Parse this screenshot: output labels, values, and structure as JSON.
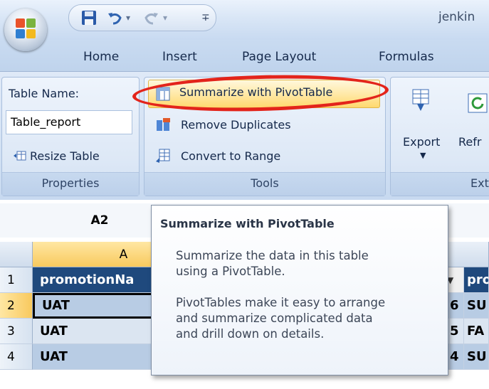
{
  "window": {
    "title": "jenkin"
  },
  "quick_access": {
    "save_icon": "save-icon",
    "undo_icon": "undo-icon",
    "redo_icon": "redo-icon",
    "customize_icon": "dropdown-icon"
  },
  "tabs": [
    "Home",
    "Insert",
    "Page Layout",
    "Formulas"
  ],
  "ribbon": {
    "properties": {
      "table_name_label": "Table Name:",
      "table_name_value": "Table_report",
      "resize_label": "Resize Table",
      "group_label": "Properties"
    },
    "tools": {
      "summarize_label": "Summarize with PivotTable",
      "remove_dup_label": "Remove Duplicates",
      "convert_label": "Convert to Range",
      "group_label": "Tools"
    },
    "external": {
      "export_label": "Export",
      "refresh_label": "Refr",
      "group_label": "Ext"
    }
  },
  "formula_bar": {
    "name_box": "A2"
  },
  "grid": {
    "column_headers": [
      "A"
    ],
    "rows": [
      {
        "num": "1",
        "a": "promotionNa",
        "right_num": "",
        "right_text": "pro"
      },
      {
        "num": "2",
        "a": "UAT",
        "right_num": "6",
        "right_text": "SU"
      },
      {
        "num": "3",
        "a": "UAT",
        "right_num": "5",
        "right_text": "FA"
      },
      {
        "num": "4",
        "a": "UAT",
        "right_num": "4",
        "right_text": "SU"
      }
    ]
  },
  "tooltip": {
    "title": "Summarize with PivotTable",
    "line1": "Summarize the data in this table",
    "line2": "using a PivotTable.",
    "line3": "PivotTables make it easy to arrange",
    "line4": "and summarize complicated data",
    "line5": "and drill down on details."
  },
  "colors": {
    "highlight_oval": "#e3241b",
    "table_header": "#1f497d"
  }
}
